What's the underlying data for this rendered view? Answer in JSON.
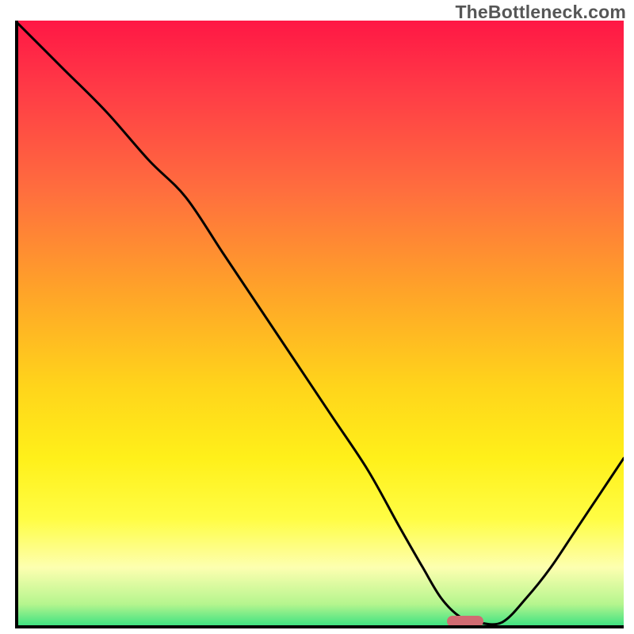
{
  "attribution": "TheBottleneck.com",
  "colors": {
    "top": "#ff1745",
    "mid1": "#ffa528",
    "mid2": "#fff01a",
    "bottom": "#2fe080",
    "curve": "#000000",
    "marker": "#d16b72",
    "axis": "#000000"
  },
  "chart_data": {
    "type": "line",
    "title": "",
    "xlabel": "",
    "ylabel": "",
    "xlim": [
      0,
      100
    ],
    "ylim": [
      0,
      100
    ],
    "grid": false,
    "series": [
      {
        "name": "bottleneck-curve",
        "x": [
          0,
          8,
          15,
          22,
          28,
          34,
          40,
          46,
          52,
          58,
          63,
          67,
          70,
          73,
          76,
          80,
          84,
          88,
          92,
          96,
          100
        ],
        "y": [
          100,
          92,
          85,
          77,
          71,
          62,
          53,
          44,
          35,
          26,
          17,
          10,
          5,
          2,
          1,
          1,
          5,
          10,
          16,
          22,
          28
        ]
      }
    ],
    "annotations": [
      {
        "name": "optimal-marker",
        "x": 74,
        "y": 1.2,
        "shape": "pill",
        "color": "#d16b72"
      }
    ],
    "background_gradient": {
      "direction": "vertical",
      "stops": [
        {
          "pos": 0.0,
          "color": "#ff1745"
        },
        {
          "pos": 0.12,
          "color": "#ff3d46"
        },
        {
          "pos": 0.28,
          "color": "#ff6e3e"
        },
        {
          "pos": 0.45,
          "color": "#ffa528"
        },
        {
          "pos": 0.6,
          "color": "#ffd41b"
        },
        {
          "pos": 0.72,
          "color": "#fff01a"
        },
        {
          "pos": 0.82,
          "color": "#fffd44"
        },
        {
          "pos": 0.9,
          "color": "#fdffb0"
        },
        {
          "pos": 0.96,
          "color": "#b5f58e"
        },
        {
          "pos": 1.0,
          "color": "#2fe080"
        }
      ]
    }
  }
}
